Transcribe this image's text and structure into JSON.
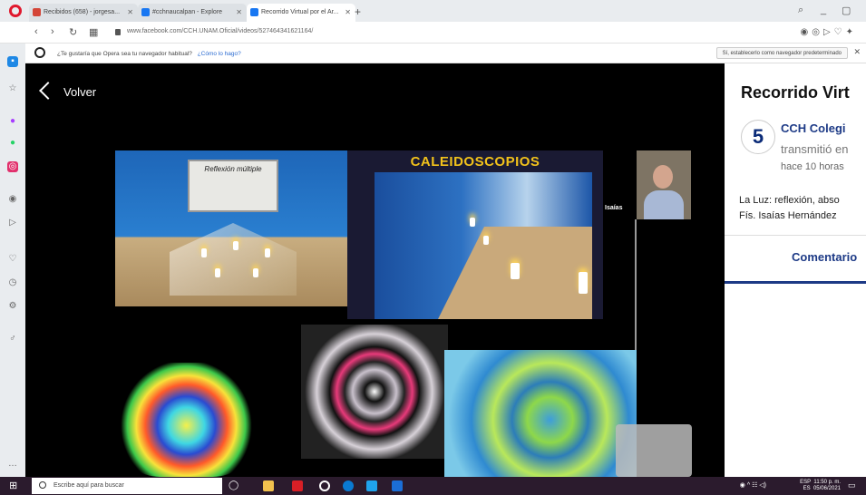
{
  "browser": {
    "tabs": [
      {
        "label": "Recibidos (658) - jorgesa...",
        "favicon_color": "#d44638"
      },
      {
        "label": "#cchnaucalpan - Explore",
        "favicon_color": "#1877f2"
      },
      {
        "label": "Recorrido Virtual por el Ar...",
        "favicon_color": "#1877f2"
      }
    ],
    "new_tab": "+",
    "url": "www.facebook.com/CCH.UNAM.Oficial/videos/527464341621164/",
    "infobar_question": "¿Te gustaría que Opera sea tu navegador habitual?",
    "infobar_link": "¿Cómo lo hago?",
    "infobar_button": "Sí, establecerlo como navegador predeterminado"
  },
  "video": {
    "back_label": "Volver",
    "caption": "CALEIDOSCOPIOS",
    "speaker": "Isaías",
    "sign_text": "Reflexión múltiple"
  },
  "post": {
    "title": "Recorrido Virt",
    "page_name": "CCH Colegi",
    "action": "transmitió en",
    "time": "hace 10 horas",
    "desc_line1": "La Luz: reflexión, abso",
    "desc_line2": "Fís. Isaías Hernández",
    "comments_label": "Comentario",
    "logo_text": "5"
  },
  "taskbar": {
    "search_placeholder": "Escribe aquí para buscar",
    "language": "ESP",
    "region": "ES",
    "time": "11:50 p. m.",
    "date": "05/06/2021"
  }
}
